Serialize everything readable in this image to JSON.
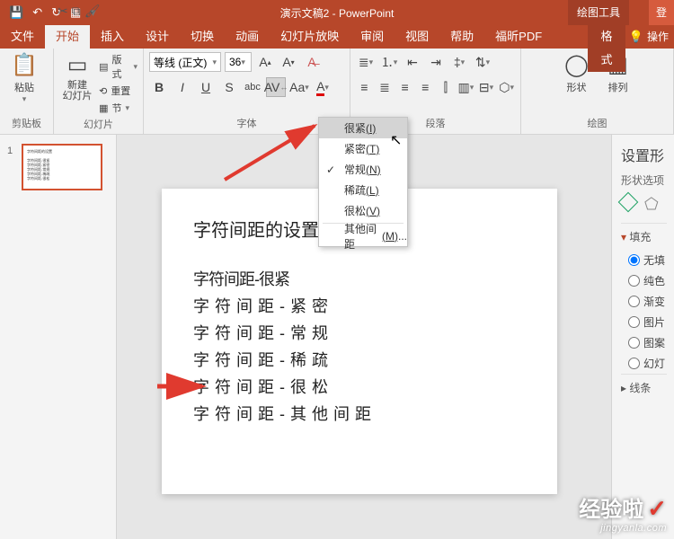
{
  "app": {
    "title": "演示文稿2 - PowerPoint",
    "context_tab": "绘图工具",
    "login": "登"
  },
  "tabs": {
    "file": "文件",
    "home": "开始",
    "insert": "插入",
    "design": "设计",
    "transition": "切换",
    "animation": "动画",
    "slideshow": "幻灯片放映",
    "review": "审阅",
    "view": "视图",
    "help": "帮助",
    "foxit": "福昕PDF",
    "format": "格式",
    "tellme": "操作"
  },
  "groups": {
    "clipboard": "剪贴板",
    "slides": "幻灯片",
    "font": "字体",
    "paragraph": "段落",
    "drawing": "绘图"
  },
  "ribbon": {
    "paste": "粘贴",
    "new_slide": "新建\n幻灯片",
    "layout": "版式",
    "reset": "重置",
    "section": "节",
    "font_name": "等线 (正文)",
    "font_size": "36",
    "shape": "形状",
    "arrange": "排列"
  },
  "font_btns": {
    "bold": "B",
    "italic": "I",
    "underline": "U",
    "strike": "S",
    "shadow": "abc"
  },
  "menu": {
    "very_tight": "很紧",
    "very_tight_k": "(I)",
    "tight": "紧密",
    "tight_k": "(T)",
    "normal": "常规",
    "normal_k": "(N)",
    "loose": "稀疏",
    "loose_k": "(L)",
    "very_loose": "很松",
    "very_loose_k": "(V)",
    "more": "其他间距",
    "more_k": "(M)",
    "more_dots": "..."
  },
  "slide": {
    "title": "字符间距的设置",
    "l1": "字符间距-很紧",
    "l2": "字 符 间 距 - 紧 密",
    "l3": "字 符 间 距 - 常 规",
    "l4": "字 符 间 距 - 稀 疏",
    "l5": "字  符  间  距  -  很  松",
    "l6": "字 符 间 距 - 其 他 间 距"
  },
  "pane": {
    "title": "设置形",
    "options": "形状选项",
    "fill": "填充",
    "line": "线条",
    "no_fill": "无填",
    "solid": "纯色",
    "gradient": "渐变",
    "picture": "图片",
    "pattern": "图案",
    "slide_bg": "幻灯"
  },
  "thumb_index": "1",
  "watermark": {
    "main": "经验啦",
    "sub": "jingyanla.com"
  }
}
